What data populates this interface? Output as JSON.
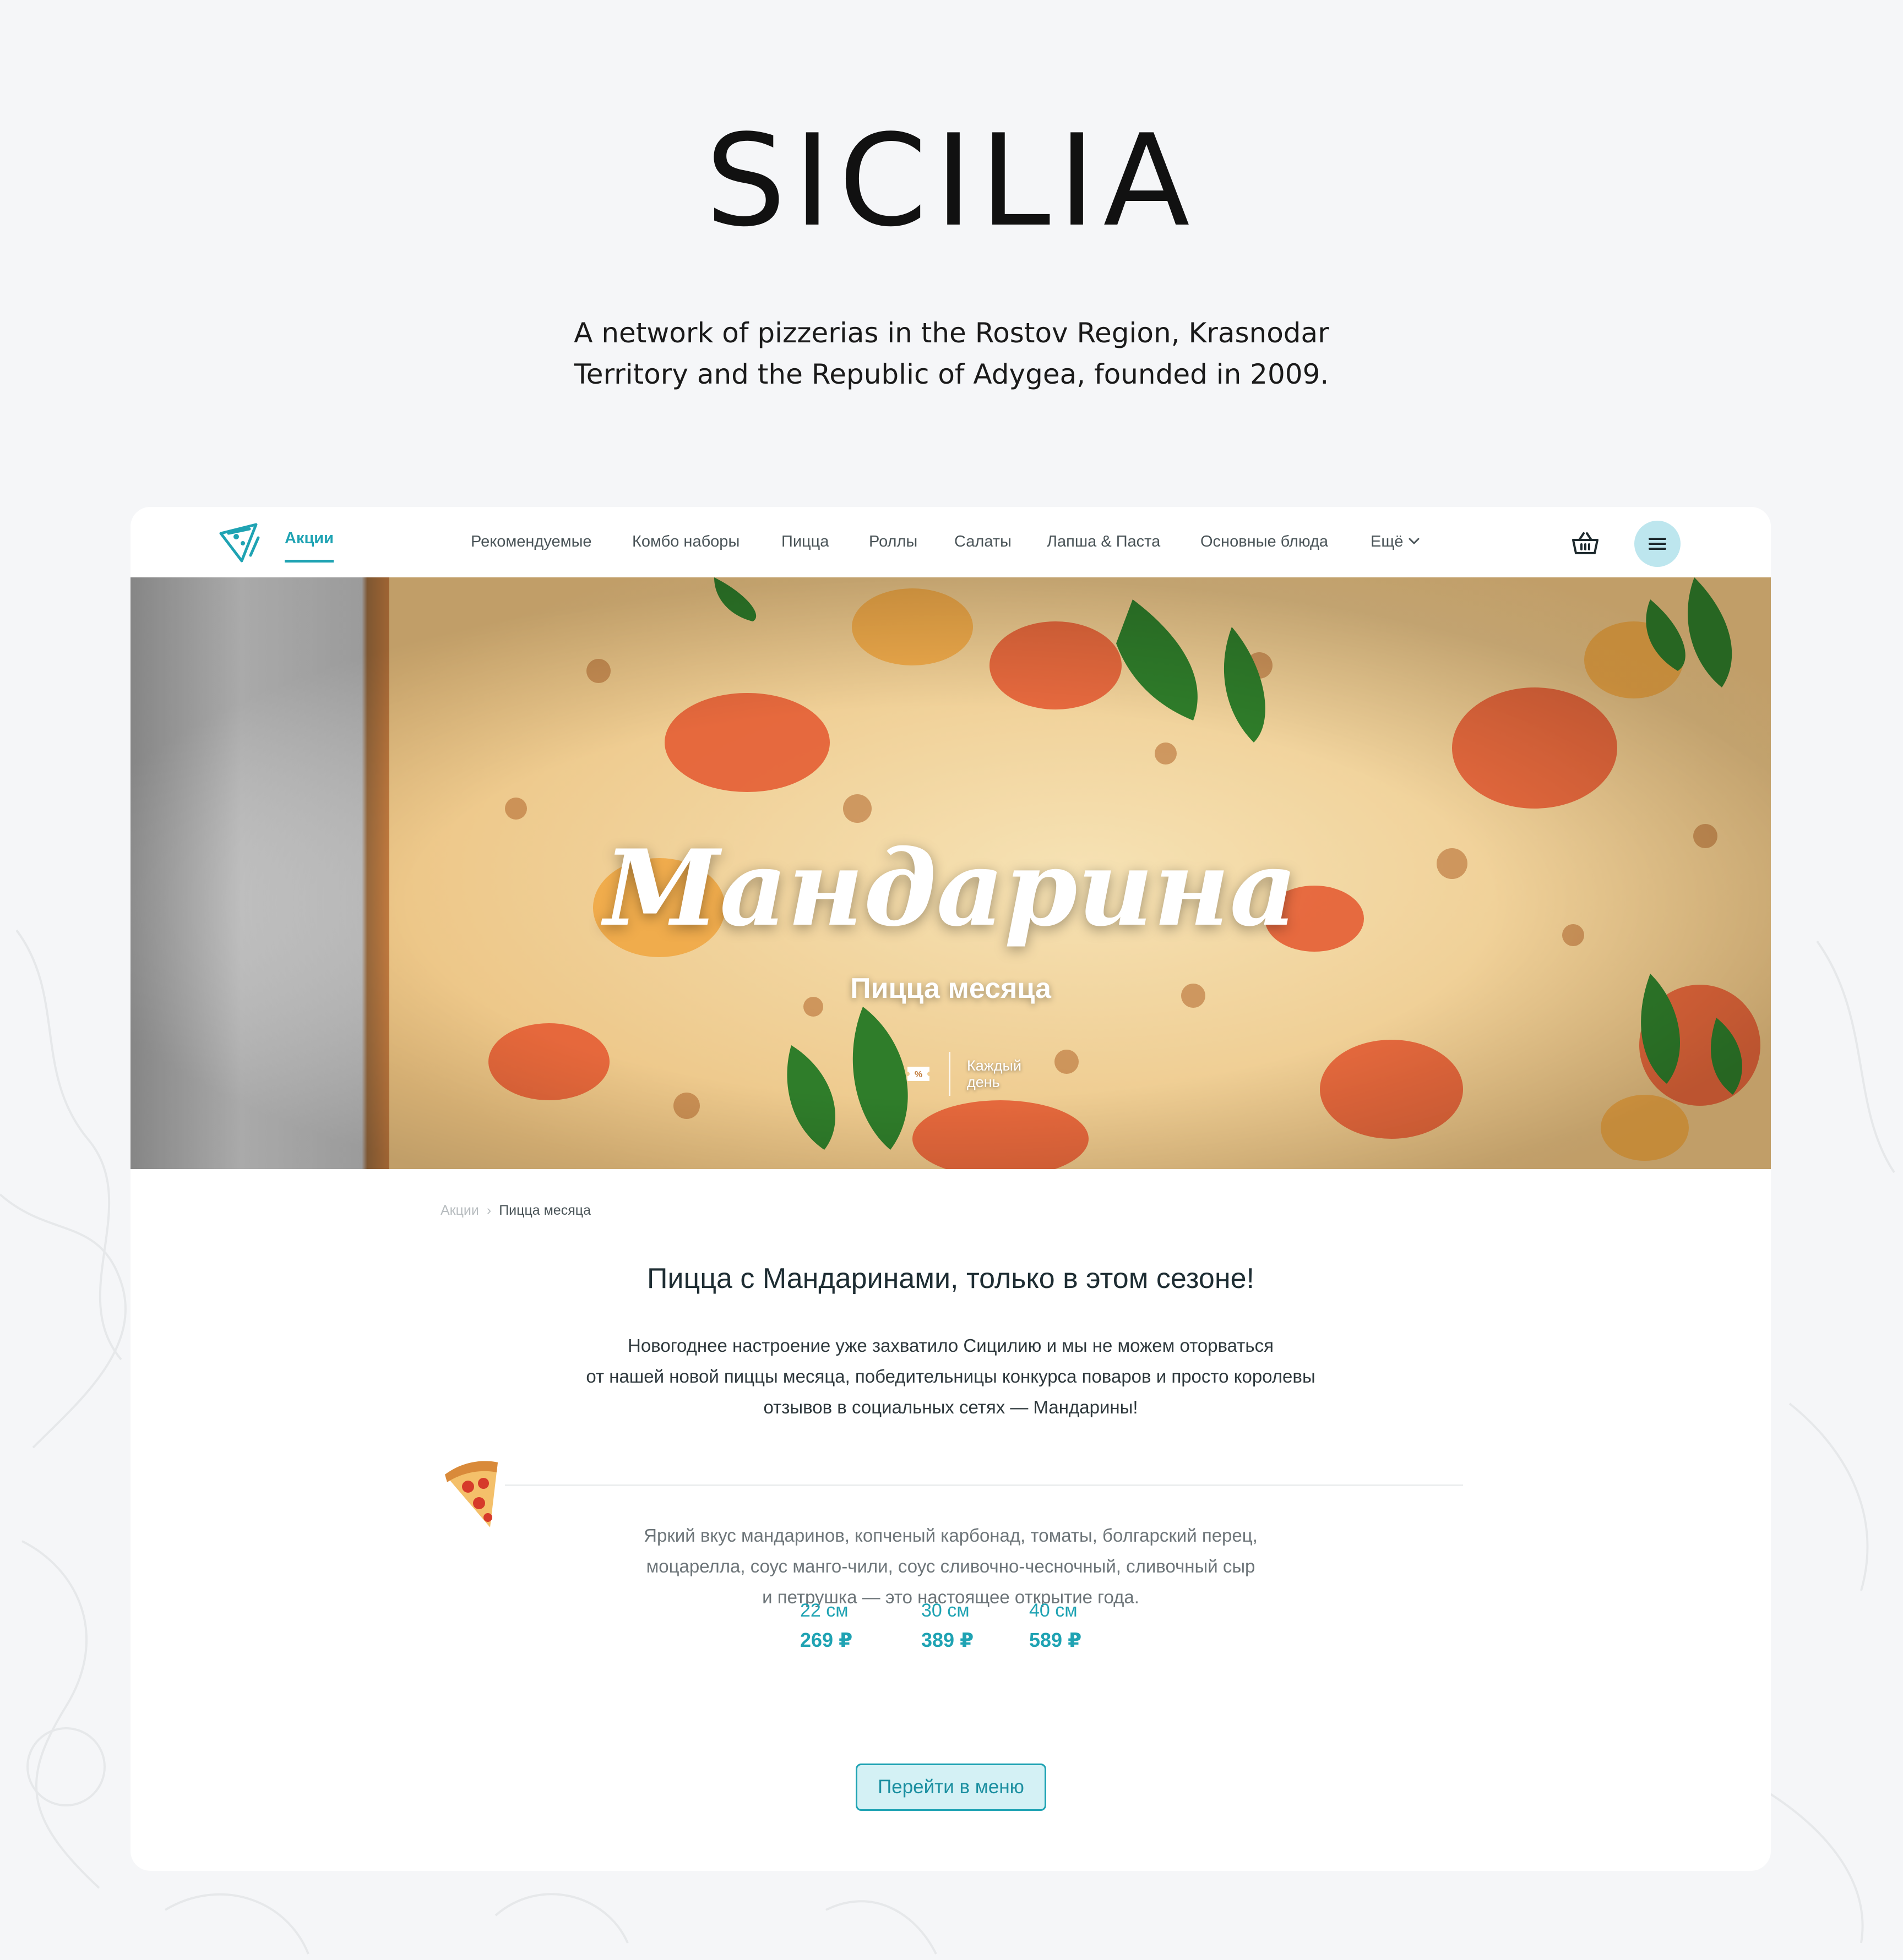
{
  "brand": {
    "title": "SICILIA",
    "description_lines": [
      "A network of pizzerias in the Rostov Region, Krasnodar",
      "Territory and the Republic of Adygea, founded in 2009."
    ]
  },
  "nav": {
    "active_label": "Акции",
    "items": [
      "Рекомендуемые",
      "Комбо наборы",
      "Пицца",
      "Роллы",
      "Салаты",
      "Лапша & Паста",
      "Основные блюда",
      "Ещё"
    ]
  },
  "hero": {
    "title": "Мандарина",
    "subtitle": "Пицца месяца",
    "badge_lines": [
      "Каждый",
      "день"
    ]
  },
  "breadcrumb": {
    "parent": "Акции",
    "separator": "›",
    "current": "Пицца месяца"
  },
  "content": {
    "headline": "Пицца с Мандаринами, только в этом сезоне!",
    "intro_lines": [
      "Новогоднее настроение уже захватило Сицилию и мы не можем оторваться",
      "от нашей новой пиццы месяца, победительницы конкурса поваров и просто королевы",
      "отзывов в социальных сетях — Мандарины!"
    ],
    "description_lines": [
      "Яркий вкус мандаринов, копченый карбонад, томаты, болгарский перец,",
      "моцарелла, соус манго-чили, соус сливочно-чесночный, сливочный сыр",
      "и петрушка — это настоящее открытие года."
    ],
    "sizes": [
      {
        "label": "22 см",
        "price": "269 ₽"
      },
      {
        "label": "30 см",
        "price": "389 ₽"
      },
      {
        "label": "40 см",
        "price": "589 ₽"
      }
    ],
    "cta_label": "Перейти в меню"
  },
  "colors": {
    "accent": "#1fa3b3",
    "accent_light": "#d4f1f5",
    "menu_button": "#bde6ee",
    "page_background": "#f5f6f8"
  },
  "icons": [
    "logo-pizza-icon",
    "chevron-down-icon",
    "basket-icon",
    "menu-icon",
    "discount-ticket-icon",
    "pizza-slice-icon"
  ]
}
